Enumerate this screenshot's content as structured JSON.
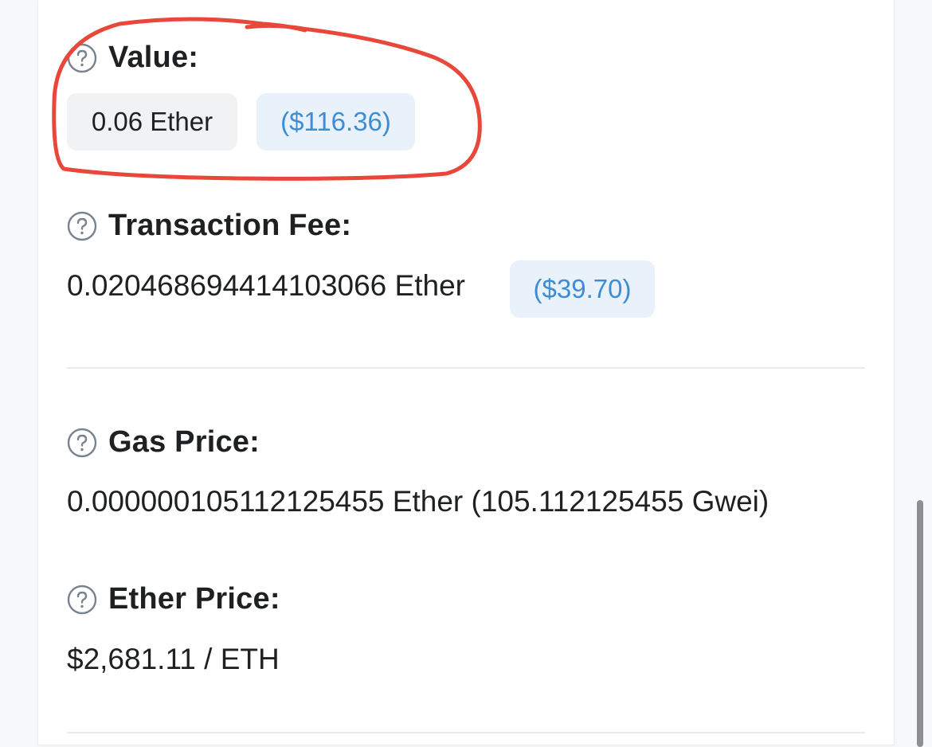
{
  "value": {
    "label": "Value:",
    "ether_amount": "0.06 Ether",
    "usd_amount": "($116.36)"
  },
  "transaction_fee": {
    "label": "Transaction Fee:",
    "ether_amount": "0.020468694414103066 Ether",
    "usd_amount": "($39.70)"
  },
  "gas_price": {
    "label": "Gas Price:",
    "value": "0.000000105112125455 Ether (105.112125455 Gwei)"
  },
  "ether_price": {
    "label": "Ether Price:",
    "value": "$2,681.11 / ETH"
  },
  "colors": {
    "annotation": "#e8473a",
    "usd_link": "#3c8dd6",
    "usd_pill_bg": "#e9f2fb",
    "ether_pill_bg": "#f1f2f4"
  },
  "icons": {
    "help": "question-circle-icon"
  }
}
